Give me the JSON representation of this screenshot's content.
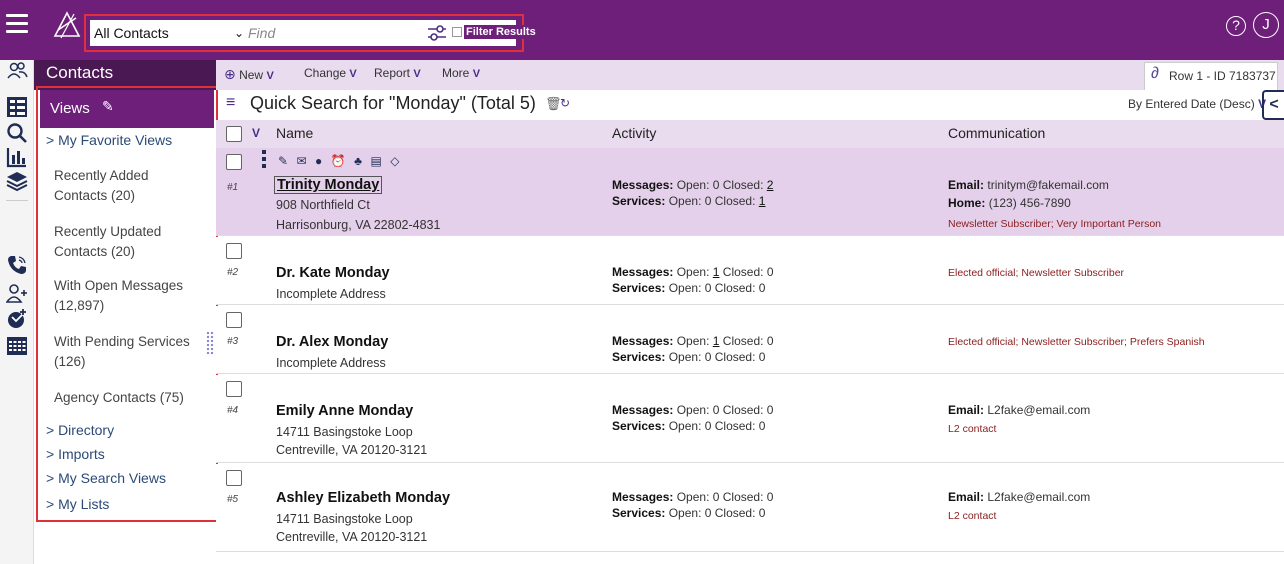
{
  "topbar": {
    "scope_select": "All Contacts",
    "find_placeholder": "Find",
    "filter_results_label": "Filter Results",
    "help_icon": "question-circle-icon",
    "user_initial": "J"
  },
  "rail": {
    "items": [
      "contacts-icon",
      "views-list-icon",
      "search-icon",
      "reports-icon",
      "layers-icon",
      "phone-icon",
      "add-person-icon",
      "add-message-icon",
      "calendar-icon"
    ]
  },
  "contacts_title": "Contacts",
  "views": {
    "title": "Views",
    "favorite": "> My Favorite Views",
    "items": [
      "Recently Added Contacts (20)",
      "Recently Updated Contacts (20)",
      "With Open Messages (12,897)",
      "With Pending Services (126)",
      "Agency Contacts (75)"
    ],
    "groups": [
      "> Directory",
      "> Imports",
      "> My Search Views",
      "> My Lists"
    ]
  },
  "toolbar": {
    "new_label": "New",
    "change_label": "Change",
    "report_label": "Report",
    "more_label": "More",
    "row_id": "Row 1 - ID 7183737"
  },
  "search": {
    "title": "Quick Search for \"Monday\" (Total 5)",
    "sort_label": "By Entered Date (Desc)"
  },
  "columns": {
    "name": "Name",
    "activity": "Activity",
    "communication": "Communication"
  },
  "rows": [
    {
      "num": "#1",
      "name": "Trinity Monday",
      "addr1": "908 Northfield Ct",
      "addr2": "Harrisonburg, VA 22802-4831",
      "messages_prefix": "Messages:",
      "messages": "Open: 0 Closed:",
      "messages_closed": "2",
      "services_prefix": "Services:",
      "services": "Open: 0 Closed:",
      "services_closed": "1",
      "email_prefix": "Email:",
      "email": "trinitym@fakemail.com",
      "home_prefix": "Home:",
      "home": "(123) 456-7890",
      "tags": "Newsletter Subscriber; Very Important Person"
    },
    {
      "num": "#2",
      "name": "Dr. Kate Monday",
      "addr1": "Incomplete Address",
      "messages_prefix": "Messages:",
      "messages_a": "Open:",
      "messages_open": "1",
      "messages_b": "Closed: 0",
      "services_prefix": "Services:",
      "services": "Open: 0 Closed: 0",
      "tags": "Elected official; Newsletter Subscriber"
    },
    {
      "num": "#3",
      "name": "Dr. Alex Monday",
      "addr1": "Incomplete Address",
      "messages_prefix": "Messages:",
      "messages_a": "Open:",
      "messages_open": "1",
      "messages_b": "Closed: 0",
      "services_prefix": "Services:",
      "services": "Open: 0 Closed: 0",
      "tags": "Elected official; Newsletter Subscriber; Prefers Spanish"
    },
    {
      "num": "#4",
      "name": "Emily Anne Monday",
      "addr1": "14711 Basingstoke Loop",
      "addr2": "Centreville, VA 20120-3121",
      "messages_prefix": "Messages:",
      "messages": "Open: 0 Closed: 0",
      "services_prefix": "Services:",
      "services": "Open: 0 Closed: 0",
      "email_prefix": "Email:",
      "email": "L2fake@email.com",
      "tags": "L2 contact"
    },
    {
      "num": "#5",
      "name": "Ashley Elizabeth Monday",
      "addr1": "14711 Basingstoke Loop",
      "addr2": "Centreville, VA 20120-3121",
      "messages_prefix": "Messages:",
      "messages": "Open: 0 Closed: 0",
      "services_prefix": "Services:",
      "services": "Open: 0 Closed: 0",
      "email_prefix": "Email:",
      "email": "L2fake@email.com",
      "tags": "L2 contact"
    }
  ],
  "colors": {
    "brand": "#6d1f7a",
    "brand_dark": "#4a1852",
    "selected_row": "#e4d0ea",
    "toolbar_bg": "#e9dcef",
    "highlight_frame": "#e0303a",
    "tag_text": "#8b1d1d"
  }
}
